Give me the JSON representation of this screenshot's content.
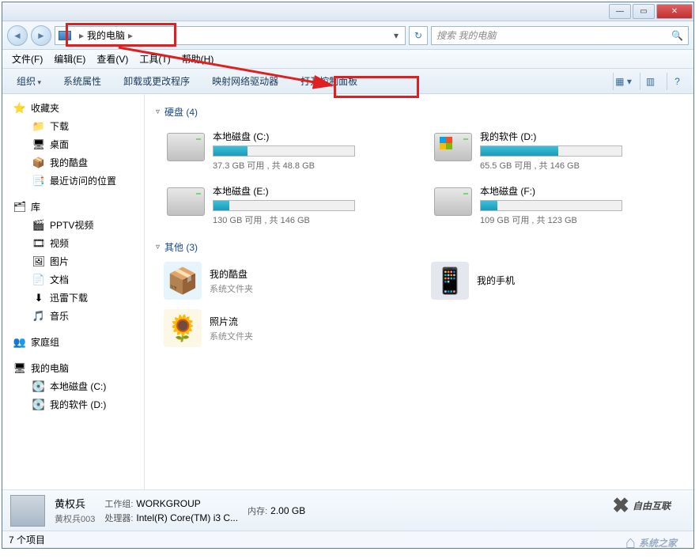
{
  "address": {
    "location": "我的电脑"
  },
  "search": {
    "placeholder": "搜索 我的电脑"
  },
  "menu": {
    "file": "文件(F)",
    "edit": "编辑(E)",
    "view": "查看(V)",
    "tools": "工具(T)",
    "help": "帮助(H)"
  },
  "toolbar": {
    "organize": "组织",
    "sysprops": "系统属性",
    "uninstall": "卸载或更改程序",
    "mapdrive": "映射网络驱动器",
    "controlpanel": "打开控制面板"
  },
  "sidebar": {
    "favorites": {
      "label": "收藏夹",
      "items": [
        "下载",
        "桌面",
        "我的酷盘",
        "最近访问的位置"
      ]
    },
    "libraries": {
      "label": "库",
      "items": [
        "PPTV视频",
        "视频",
        "图片",
        "文档",
        "迅雷下载",
        "音乐"
      ]
    },
    "homegroup": "家庭组",
    "computer": {
      "label": "我的电脑",
      "items": [
        "本地磁盘 (C:)",
        "我的软件 (D:)"
      ]
    }
  },
  "content": {
    "hdd_label": "硬盘 (4)",
    "other_label": "其他 (3)",
    "drives": [
      {
        "name": "本地磁盘 (C:)",
        "stats": "37.3 GB 可用 , 共 48.8 GB",
        "fill": 24,
        "win": false
      },
      {
        "name": "我的软件 (D:)",
        "stats": "65.5 GB 可用 , 共 146 GB",
        "fill": 55,
        "win": true
      },
      {
        "name": "本地磁盘 (E:)",
        "stats": "130 GB 可用 , 共 146 GB",
        "fill": 11,
        "win": false
      },
      {
        "name": "本地磁盘 (F:)",
        "stats": "109 GB 可用 , 共 123 GB",
        "fill": 12,
        "win": false
      }
    ],
    "others": [
      {
        "name": "我的酷盘",
        "sub": "系统文件夹",
        "icon": "📦",
        "bg": "#38b0e8"
      },
      {
        "name": "我的手机",
        "sub": "",
        "icon": "📱",
        "bg": "#2a4a7a"
      },
      {
        "name": "照片流",
        "sub": "系统文件夹",
        "icon": "🌻",
        "bg": "#f0c030"
      }
    ]
  },
  "details": {
    "name": "黄权兵",
    "sub": "黄权兵003",
    "workgroup_k": "工作组:",
    "workgroup_v": "WORKGROUP",
    "cpu_k": "处理器:",
    "cpu_v": "Intel(R) Core(TM) i3 C...",
    "mem_k": "内存:",
    "mem_v": "2.00 GB"
  },
  "status": {
    "text": "7 个项目"
  },
  "watermark1": "自由互联",
  "watermark2": "系统之家"
}
